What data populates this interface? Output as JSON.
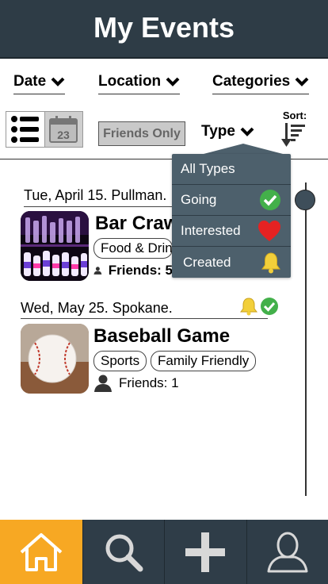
{
  "header": {
    "title": "My Events"
  },
  "filters": {
    "date_label": "Date",
    "location_label": "Location",
    "categories_label": "Categories",
    "friends_only_label": "Friends Only",
    "type_label": "Type",
    "sort_label": "Sort:",
    "calendar_day": "23"
  },
  "type_dropdown": {
    "items": [
      {
        "label": "All Types",
        "icon": "none"
      },
      {
        "label": "Going",
        "icon": "check-circle-icon"
      },
      {
        "label": "Interested",
        "icon": "heart-icon"
      },
      {
        "label": "Created",
        "icon": "bell-icon"
      }
    ]
  },
  "events": [
    {
      "date": "Tue, April 15. Pullman.",
      "title": "Bar Crawl",
      "tags": [
        "Food & Drink"
      ],
      "friends": "Friends: 5"
    },
    {
      "date": "Wed, May 25. Spokane.",
      "title": "Baseball Game",
      "tags": [
        "Sports",
        "Family Friendly"
      ],
      "friends": "Friends: 1"
    }
  ],
  "bottom_nav": {
    "items": [
      {
        "icon": "home-icon",
        "active": true
      },
      {
        "icon": "search-icon",
        "active": false
      },
      {
        "icon": "add-icon",
        "active": false
      },
      {
        "icon": "profile-icon",
        "active": false
      }
    ]
  },
  "colors": {
    "header_bg": "#2e3c46",
    "dropdown_bg": "#4d606c",
    "nav_bg": "#2f3d48",
    "nav_active": "#f7a823",
    "going_green": "#43b04a",
    "heart_red": "#e52222",
    "bell_yellow": "#f2cf3a"
  }
}
